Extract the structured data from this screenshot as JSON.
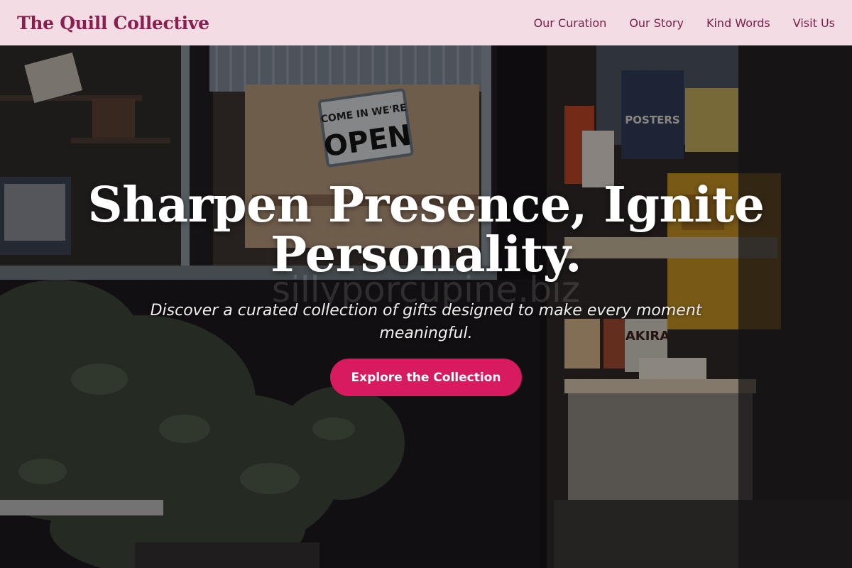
{
  "header": {
    "brand": "The Quill Collective",
    "nav": [
      {
        "label": "Our Curation"
      },
      {
        "label": "Our Story"
      },
      {
        "label": "Kind Words"
      },
      {
        "label": "Visit Us"
      }
    ]
  },
  "hero": {
    "headline_line1": "Sharpen Presence, Ignite",
    "headline_line2": "Personality.",
    "subhead": "Discover a curated collection of gifts designed to make every moment meaningful.",
    "watermark": "sillyporcupine.biz",
    "cta_label": "Explore the Collection",
    "sign_text_1": "COME IN WE'RE",
    "sign_text_2": "OPEN",
    "poster_text": "POSTERS",
    "book_text": "AKIRA"
  },
  "colors": {
    "header_bg": "#f4dce4",
    "brand": "#8a1f4f",
    "accent": "#d81b60"
  }
}
